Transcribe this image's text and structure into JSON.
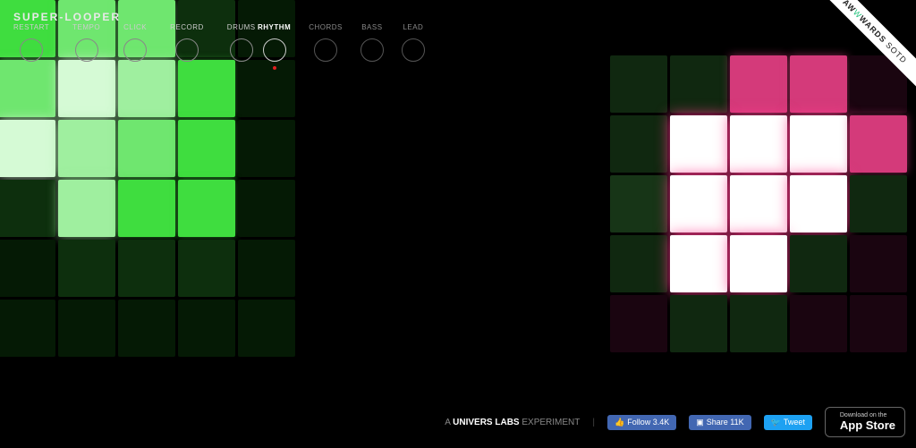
{
  "app_title": "SUPER-LOOPER",
  "controls": [
    {
      "label": "RESTART"
    },
    {
      "label": "TEMPO"
    },
    {
      "label": "CLICK"
    },
    {
      "label": "RECORD"
    },
    {
      "label": "DRUMS"
    }
  ],
  "tabs": [
    {
      "label": "RHYTHM",
      "active": true
    },
    {
      "label": "CHORDS",
      "active": false
    },
    {
      "label": "BASS",
      "active": false
    },
    {
      "label": "LEAD",
      "active": false
    }
  ],
  "ribbon": {
    "brand_pre": "AW",
    "brand_mid": "W",
    "brand_post": "WARDS",
    "suffix": "SOTD"
  },
  "footer": {
    "credit_pre": "A ",
    "credit_strong": "UNIVERS LABS",
    "credit_post": " EXPERIMENT",
    "fb_follow": "Follow 3.4K",
    "fb_share": "Share 11K",
    "tw": "Tweet",
    "appstore_small": "Download on the",
    "appstore_big": "App Store"
  },
  "grids": {
    "left": [
      [
        "g3",
        "g4",
        "g4",
        "g1",
        "g0"
      ],
      [
        "g4",
        "g6",
        "g5",
        "g3",
        "g0"
      ],
      [
        "g6",
        "g5",
        "g4",
        "g3",
        "g0"
      ],
      [
        "g1",
        "g5",
        "g3",
        "g3",
        "g0"
      ],
      [
        "g0",
        "g1",
        "g1",
        "g1",
        "g0"
      ],
      [
        "g0",
        "g0",
        "g0",
        "g0",
        "g0"
      ]
    ],
    "right": [
      [
        "p1",
        "p1",
        "p3",
        "p3",
        "p0"
      ],
      [
        "p1",
        "p4",
        "p4",
        "p4",
        "p5"
      ],
      [
        "p2",
        "p4",
        "p4",
        "p4",
        "p1"
      ],
      [
        "p1",
        "p4",
        "p4",
        "p1",
        "p0"
      ],
      [
        "p0",
        "p1",
        "p1",
        "p0",
        "p0"
      ]
    ]
  }
}
